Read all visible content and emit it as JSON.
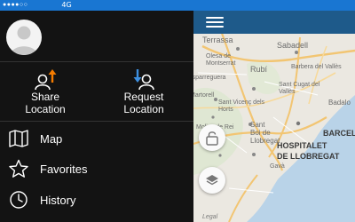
{
  "status_bar": {
    "signal": "●●●●○○",
    "carrier": "4G"
  },
  "drawer": {
    "actions": [
      {
        "label_line1": "Share",
        "label_line2": "Location",
        "icon": "share-location-icon"
      },
      {
        "label_line1": "Request",
        "label_line2": "Location",
        "icon": "request-location-icon"
      }
    ],
    "menu": [
      {
        "label": "Map",
        "icon": "map-icon"
      },
      {
        "label": "Favorites",
        "icon": "star-icon"
      },
      {
        "label": "History",
        "icon": "clock-icon"
      }
    ]
  },
  "map": {
    "towns": {
      "terrassa": "Terrassa",
      "sabadell": "Sabadell",
      "olesa": "Olesa de Montserrat",
      "rubi": "Rubí",
      "barbera": "Barbera del Vallès",
      "esparreguera": "Esparreguera",
      "martorell": "Martorell",
      "sant_cugat": "Sant Cugat del Vallès",
      "sant_vicenc": "Sant Vicenç dels Horts",
      "molins": "Molins de Rei",
      "sant_boi_1": "Sant",
      "sant_boi_2": "Boi de",
      "sant_boi_3": "Llobregat",
      "gava": "Gavà",
      "badalona": "Badalo",
      "logo": "Legal"
    },
    "city_1": "BARCELON",
    "city_2a": "HOSPITALET",
    "city_2b": "DE LLOBREGAT"
  },
  "colors": {
    "accent": "#1976d2",
    "map_bar": "#1e5a8a",
    "drawer_bg": "#131313",
    "share_arrow": "#f57c00",
    "request_arrow": "#3d8fe0"
  }
}
